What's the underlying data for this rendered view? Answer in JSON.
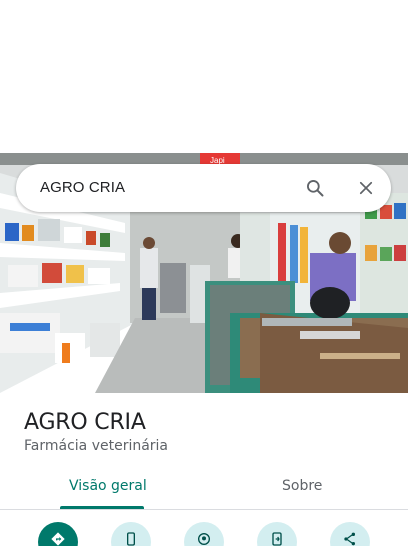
{
  "search": {
    "query": "AGRO CRIA",
    "search_icon": "search-icon",
    "clear_icon": "close-icon"
  },
  "photo": {
    "sign_text": "Japi"
  },
  "place": {
    "name": "AGRO CRIA",
    "category": "Farmácia veterinária"
  },
  "tabs": [
    {
      "label": "Visão geral",
      "selected": true
    },
    {
      "label": "Sobre",
      "selected": false
    }
  ],
  "actions": [
    {
      "icon": "directions-icon"
    },
    {
      "icon": "phone-icon"
    },
    {
      "icon": "nearby-icon"
    },
    {
      "icon": "send-to-phone-icon"
    },
    {
      "icon": "share-icon"
    }
  ],
  "colors": {
    "accent": "#00796b",
    "action_bg": "#d3eef0",
    "text_primary": "#202124",
    "text_secondary": "#5f6368"
  }
}
